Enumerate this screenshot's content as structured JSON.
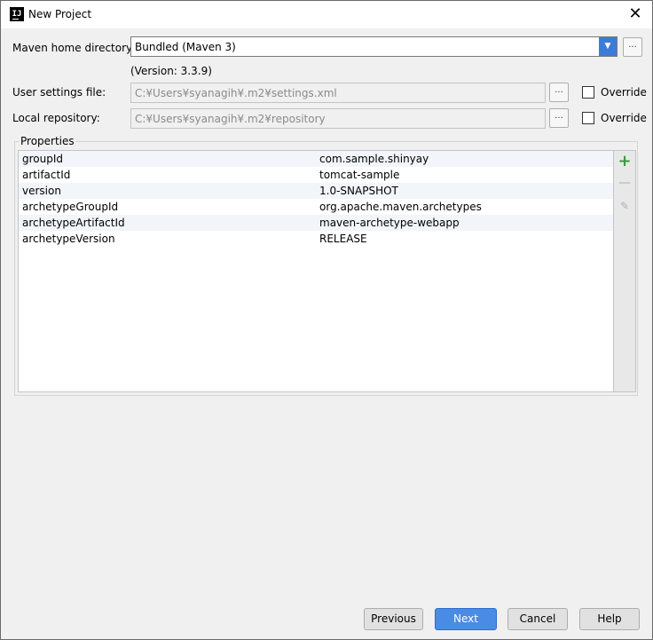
{
  "window": {
    "title": "New Project"
  },
  "maven": {
    "home_label": "Maven home directory:",
    "home_value": "Bundled (Maven 3)",
    "version_text": "(Version: 3.3.9)",
    "user_settings_label": "User settings file:",
    "user_settings_value": "C:¥Users¥syanagih¥.m2¥settings.xml",
    "local_repo_label": "Local repository:",
    "local_repo_value": "C:¥Users¥syanagih¥.m2¥repository",
    "override_label": "Override",
    "browse_label": "..."
  },
  "properties": {
    "legend": "Properties",
    "rows": [
      {
        "key": "groupId",
        "value": "com.sample.shinyay"
      },
      {
        "key": "artifactId",
        "value": "tomcat-sample"
      },
      {
        "key": "version",
        "value": "1.0-SNAPSHOT"
      },
      {
        "key": "archetypeGroupId",
        "value": "org.apache.maven.archetypes"
      },
      {
        "key": "archetypeArtifactId",
        "value": "maven-archetype-webapp"
      },
      {
        "key": "archetypeVersion",
        "value": "RELEASE"
      }
    ]
  },
  "buttons": {
    "previous": "Previous",
    "next": "Next",
    "cancel": "Cancel",
    "help": "Help"
  },
  "icons": {
    "app": "intellij-icon",
    "close": "close-icon",
    "dropdown": "chevron-down-icon",
    "add": "plus-icon",
    "remove": "minus-icon",
    "edit": "pencil-icon"
  },
  "colors": {
    "accent": "#3d7bd9",
    "add_icon": "#3a9a3a"
  }
}
